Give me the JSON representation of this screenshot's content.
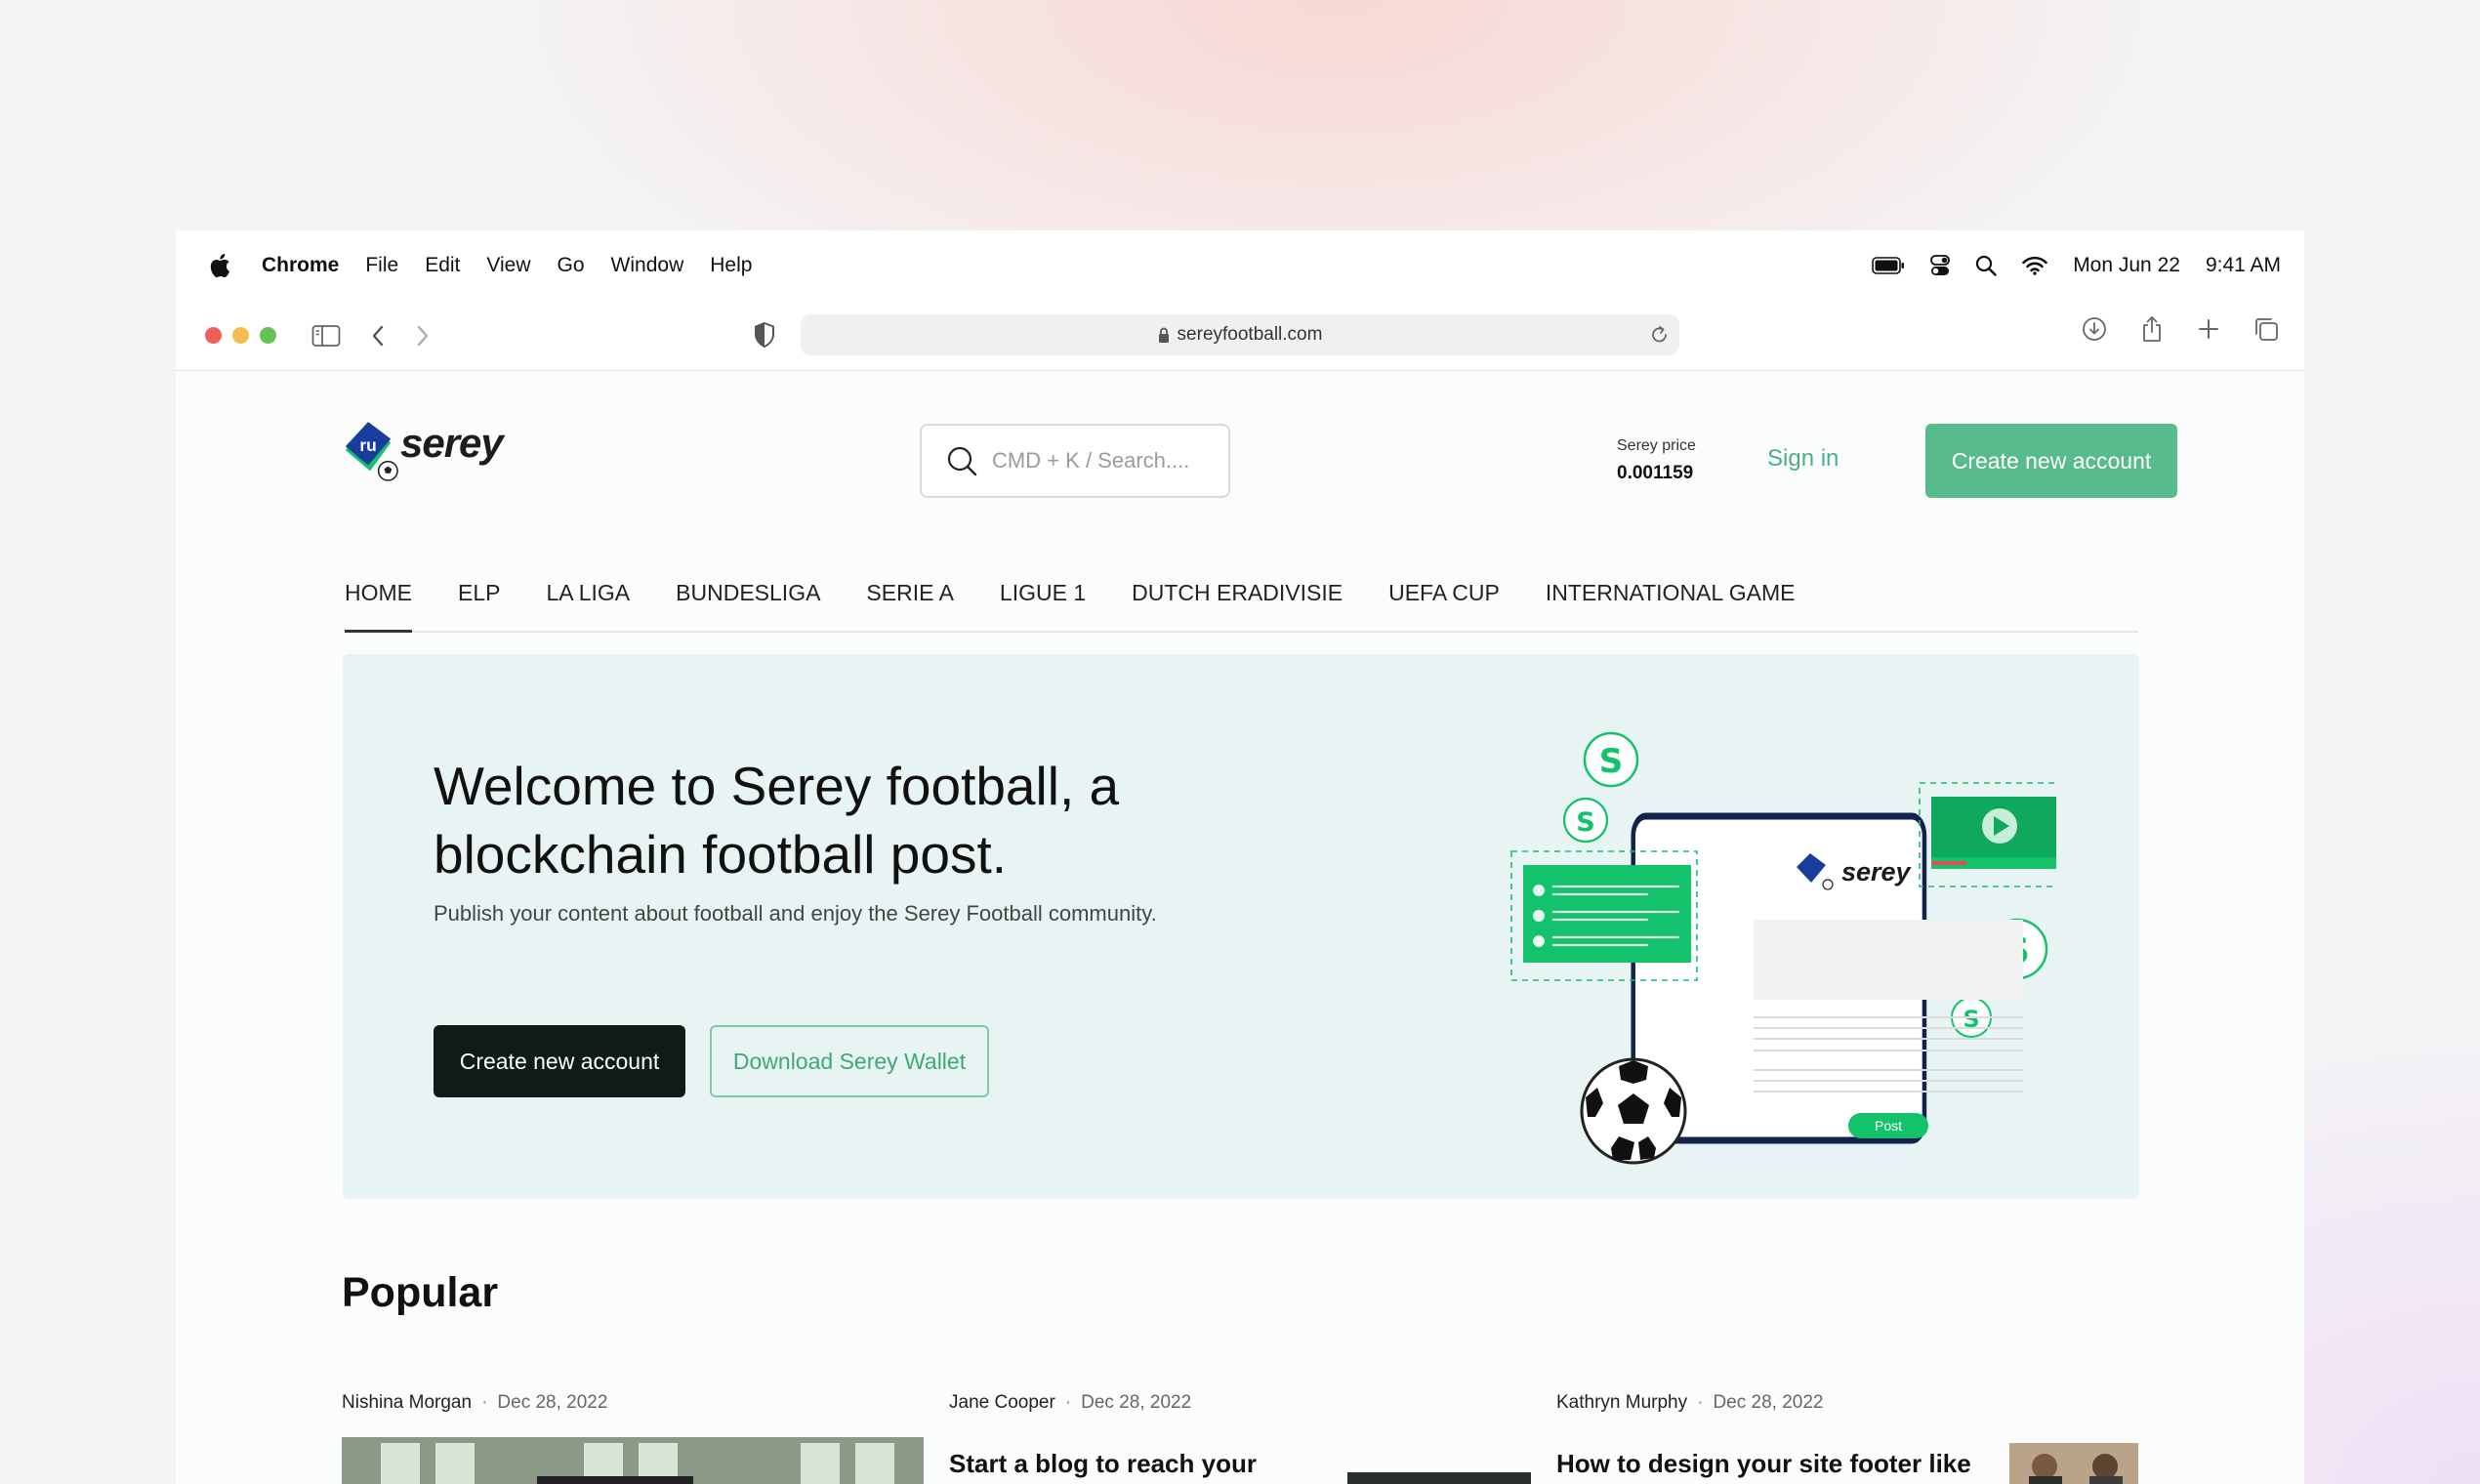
{
  "menubar": {
    "app": "Chrome",
    "items": [
      "File",
      "Edit",
      "View",
      "Go",
      "Window",
      "Help"
    ],
    "date": "Mon Jun 22",
    "time": "9:41 AM"
  },
  "browser": {
    "url": "sereyfootball.com"
  },
  "header": {
    "logo_text": "serey",
    "search_placeholder": "CMD + K / Search....",
    "price_label": "Serey price",
    "price_value": "0.001159",
    "signin": "Sign in",
    "create_account": "Create new account"
  },
  "nav": {
    "items": [
      "HOME",
      "ELP",
      "LA LIGA",
      "BUNDESLIGA",
      "SERIE A",
      "LIGUE 1",
      "DUTCH ERADIVISIE",
      "UEFA CUP",
      "INTERNATIONAL GAME"
    ],
    "active": "HOME"
  },
  "hero": {
    "title_line1": "Welcome to Serey football, a",
    "title_line2": "blockchain football post.",
    "subtitle": "Publish your content about football and enjoy the Serey Football community.",
    "primary_button": "Create new account",
    "secondary_button": "Download Serey Wallet",
    "illustration": {
      "logo_text": "serey",
      "post_button": "Post",
      "coin_symbol": "S"
    }
  },
  "popular": {
    "title": "Popular",
    "posts": [
      {
        "author": "Nishina Morgan",
        "date": "Dec 28, 2022",
        "title": ""
      },
      {
        "author": "Jane Cooper",
        "date": "Dec 28, 2022",
        "title": "Start a blog to reach your"
      },
      {
        "author": "Kathryn Murphy",
        "date": "Dec 28, 2022",
        "title": "How to design your site footer like"
      }
    ]
  },
  "colors": {
    "accent": "#58bb8b",
    "hero_bg": "#e8f4f3",
    "dark_button": "#0f1c16",
    "coin_green": "#13c26b"
  }
}
